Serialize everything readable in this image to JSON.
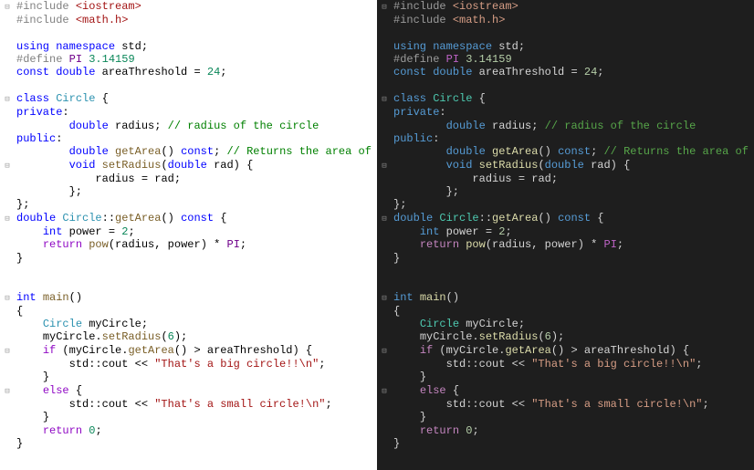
{
  "code": {
    "inc1": "#include",
    "inc1h": "<iostream>",
    "inc2": "#include",
    "inc2h": "<math.h>",
    "using": "using",
    "namespace": "namespace",
    "std": "std",
    "define": "#define",
    "pi": "PI",
    "pival": "3.14159",
    "const": "const",
    "double": "double",
    "areaThreshold": "areaThreshold",
    "eq": "=",
    "v24": "24",
    "class": "class",
    "Circle": "Circle",
    "private": "private",
    "radius": "radius",
    "cm_radius": "// radius of the circle",
    "public": "public",
    "getArea": "getArea",
    "constkw": "const",
    "cm_getarea": "// Returns the area of the circle",
    "void": "void",
    "setRadius": "setRadius",
    "rad": "rad",
    "int": "int",
    "power": "power",
    "v2": "2",
    "return": "return",
    "pow": "pow",
    "main": "main",
    "myCircle": "myCircle",
    "v6": "6",
    "if": "if",
    "else": "else",
    "cout": "std::cout",
    "ltlt": "<<",
    "str_big": "\"That's a big circle!!\\n\"",
    "str_small": "\"That's a small circle!\\n\"",
    "v0": "0"
  }
}
